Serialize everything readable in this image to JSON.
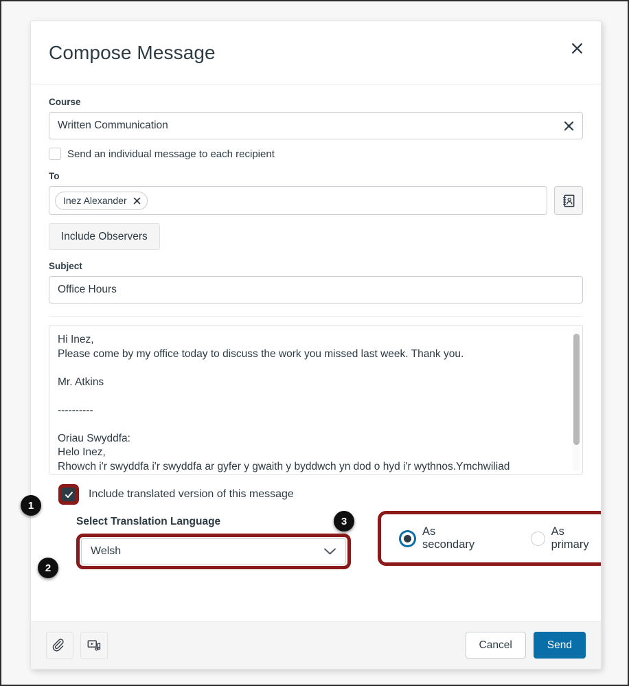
{
  "modal": {
    "title": "Compose Message",
    "close_label": "×",
    "course": {
      "label": "Course",
      "value": "Written Communication",
      "clear_label": "×"
    },
    "individual_message": {
      "label": "Send an individual message to each recipient",
      "checked": false
    },
    "to": {
      "label": "To",
      "recipients": [
        {
          "name": "Inez Alexander",
          "remove_label": "×"
        }
      ],
      "address_book_icon": "address-book-icon"
    },
    "include_observers_label": "Include Observers",
    "subject": {
      "label": "Subject",
      "value": "Office Hours"
    },
    "body": {
      "text": "Hi Inez,\nPlease come by my office today to discuss the work you missed last week. Thank you.\n\nMr. Atkins\n\n----------\n\nOriau Swyddfa:\nHelo Inez,\nRhowch i'r swyddfa i'r swyddfa ar gyfer y gwaith y byddwch yn dod o hyd i'r wythnos.Ymchwiliad"
    },
    "translation": {
      "include_label": "Include translated version of this message",
      "include_checked": true,
      "language_label": "Select Translation Language",
      "language_value": "Welsh",
      "placement_options": [
        {
          "label": "As secondary",
          "selected": true
        },
        {
          "label": "As primary",
          "selected": false
        }
      ]
    },
    "footer": {
      "attachment_icon": "paperclip-icon",
      "media_icon": "media-comment-icon",
      "cancel_label": "Cancel",
      "send_label": "Send"
    }
  },
  "annotations": {
    "badges": [
      {
        "number": "1"
      },
      {
        "number": "2"
      },
      {
        "number": "3"
      }
    ],
    "highlight_color": "#8c1919"
  },
  "colors": {
    "primary_button": "#0a6ea8",
    "text": "#2d3b45",
    "border": "#c7cdd1",
    "badge": "#0f0f0f"
  }
}
